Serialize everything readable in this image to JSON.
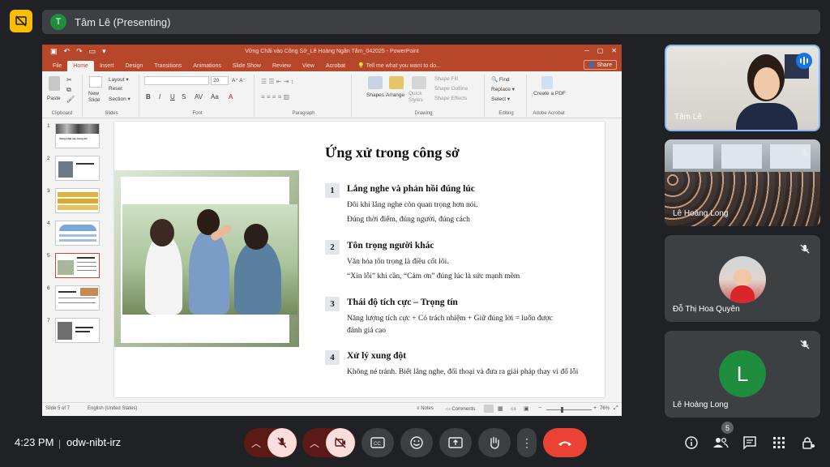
{
  "presenting": {
    "avatar_letter": "T",
    "label": "Tâm Lê (Presenting)"
  },
  "ppt": {
    "doc_title": "Vững Chãi vào Công Sở_Lê Hoàng Ngân Tâm_042025 - PowerPoint",
    "tabs": [
      "File",
      "Home",
      "Insert",
      "Design",
      "Transitions",
      "Animations",
      "Slide Show",
      "Review",
      "View",
      "Acrobat"
    ],
    "active_tab": "Home",
    "tell_me": "Tell me what you want to do...",
    "share": "Share",
    "ribbon": {
      "paste": "Paste",
      "clipboard": "Clipboard",
      "new_slide": "New Slide",
      "layout": "Layout",
      "reset": "Reset",
      "section": "Section",
      "slides": "Slides",
      "font_size": "20",
      "font": "Font",
      "paragraph": "Paragraph",
      "shapes": "Shapes",
      "arrange": "Arrange",
      "quick_styles": "Quick Styles",
      "shape_fill": "Shape Fill",
      "shape_outline": "Shape Outline",
      "shape_effects": "Shape Effects",
      "drawing": "Drawing",
      "find": "Find",
      "replace": "Replace",
      "select": "Select",
      "editing": "Editing",
      "create_pdf": "Create a PDF",
      "adobe": "Adobe Acrobat"
    },
    "thumb_numbers": [
      "1",
      "2",
      "3",
      "4",
      "5",
      "6",
      "7"
    ],
    "thumb_title_1": "Vững Chãi vào Công Sở",
    "slide": {
      "heading": "Ứng xử trong công sở",
      "items": [
        {
          "num": "1",
          "title": "Lắng nghe và phản hồi đúng lúc",
          "lines": [
            "Đôi khi lắng nghe còn quan trọng hơn nói.",
            "Đúng thời điểm, đúng người, đúng cách"
          ]
        },
        {
          "num": "2",
          "title": "Tôn trọng người khác",
          "lines": [
            "Văn hóa tôn trọng là điều cốt lõi.",
            "“Xin lỗi” khi cần, “Cảm ơn” đúng lúc là sức mạnh mềm"
          ]
        },
        {
          "num": "3",
          "title": "Thái độ tích cực – Trọng tín",
          "lines": [
            "Năng lượng tích cực + Có trách nhiệm + Giữ đúng lời = luôn được",
            "đánh giá cao"
          ]
        },
        {
          "num": "4",
          "title": "Xử lý xung đột",
          "lines": [
            "Không né tránh. Biết lắng nghe, đối thoại và đưa ra giải pháp thay vì đổ lỗi"
          ]
        }
      ]
    },
    "status": {
      "slide_of": "Slide 5 of 7",
      "language": "English (United States)",
      "notes": "Notes",
      "comments": "Comments",
      "zoom": "76%"
    }
  },
  "participants": [
    {
      "name": "Tâm Lê",
      "speaking": true
    },
    {
      "name": "Lê Hoàng Long",
      "muted": true
    },
    {
      "name": "Đỗ Thị Hoa Quyên",
      "muted": true
    },
    {
      "name": "Lê Hoàng Long",
      "muted": true,
      "avatar_letter": "L",
      "avatar_color": "#1e8e3e"
    }
  ],
  "bottom": {
    "time": "4:23 PM",
    "separator": "|",
    "meeting_code": "odw-nibt-irz",
    "people_count": "5"
  },
  "colors": {
    "accent_red": "#ea4335",
    "ppt_orange": "#b7472a",
    "meet_yellow": "#fbbc04"
  }
}
